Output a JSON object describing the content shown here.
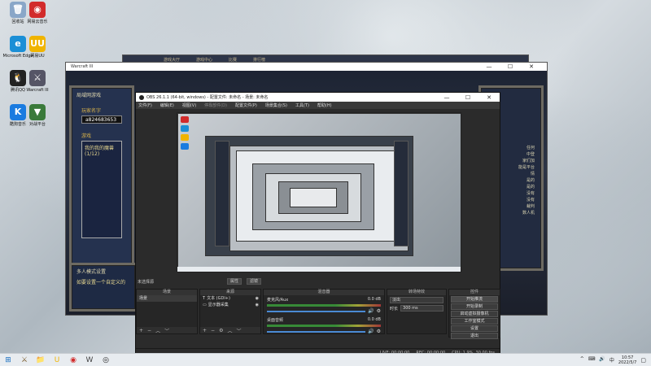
{
  "desktop_icons": [
    {
      "label": "回收站",
      "name": "recycle-bin-icon",
      "glyph": "🗑",
      "color": "#8aa7c8"
    },
    {
      "label": "网易云音乐",
      "name": "netease-music-icon",
      "glyph": "◉",
      "color": "#d22b2b"
    },
    {
      "label": "Microsoft Edge",
      "name": "edge-icon",
      "glyph": "e",
      "color": "#1b8fd6"
    },
    {
      "label": "网易UU",
      "name": "uu-icon",
      "glyph": "UU",
      "color": "#f0b400"
    },
    {
      "label": "腾讯QQ",
      "name": "qq-icon",
      "glyph": "🐧",
      "color": "#222"
    },
    {
      "label": "Warcraft III",
      "name": "warcraft-icon",
      "glyph": "⚔",
      "color": "#556"
    },
    {
      "label": "酷狗音乐",
      "name": "kugou-icon",
      "glyph": "K",
      "color": "#1a7be0"
    },
    {
      "label": "对战平台",
      "name": "battle-platform-icon",
      "glyph": "▼",
      "color": "#3a7a3a"
    }
  ],
  "war3": {
    "title": "Warcraft III",
    "portal_tabs": [
      "游戏大厅",
      "游戏中心",
      "比赛",
      "排行榜"
    ],
    "lan_title": "局域网游戏",
    "player_name_label": "玩家名字",
    "player_name_value": "a824683653",
    "games_label": "游戏",
    "game_item": "我的我的魔兽 (1/12)",
    "multiplayer_title": "多人模式设置",
    "multiplayer_hint": "如要设置一个自定义的",
    "right_lines": [
      "任何",
      "中登",
      "家们加",
      "能是平台",
      "情",
      "是的",
      "是的",
      "没有",
      "没有",
      "裁判",
      "数人机"
    ]
  },
  "obs": {
    "title": "OBS 26.1.1 (64-bit, windows) - 配置文件: 未命名 - 场景: 未命名",
    "menu": [
      "文件(F)",
      "编辑(E)",
      "视图(V)",
      "停靠部件(D)",
      "配置文件(P)",
      "场景集合(S)",
      "工具(T)",
      "帮助(H)"
    ],
    "no_source": "未选择源",
    "props_btn": "属性",
    "filters_btn": "滤镜",
    "docks": {
      "scenes": {
        "title": "场景",
        "items": [
          "场景"
        ]
      },
      "sources": {
        "title": "来源",
        "items": [
          {
            "label": "文本 (GDI+)",
            "icon": "text-icon"
          },
          {
            "label": "显示器采集",
            "icon": "monitor-icon"
          }
        ]
      },
      "mixer": {
        "title": "混音器",
        "tracks": [
          {
            "name": "麦克风/Aux",
            "db": "0.0 dB"
          },
          {
            "name": "桌面音频",
            "db": "0.0 dB"
          }
        ]
      },
      "transitions": {
        "title": "转场特效",
        "type": "淡出",
        "duration_label": "时长",
        "duration_value": "300 ms"
      },
      "controls": {
        "title": "控件",
        "buttons": [
          "开始推流",
          "开始录制",
          "启动虚拟摄像机",
          "工作室模式",
          "设置",
          "退出"
        ]
      }
    },
    "status": {
      "live": "LIVE: 00:00:00",
      "rec": "REC: 00:00:00",
      "cpu": "CPU: 1.9%, 30.00 fps"
    }
  },
  "taskbar": {
    "time": "10:57",
    "date": "2022/5/7",
    "icons": [
      {
        "name": "start-icon",
        "glyph": "⊞",
        "color": "#1a6fc0"
      },
      {
        "name": "warcraft-task-icon",
        "glyph": "⚔",
        "color": "#7a5a2a"
      },
      {
        "name": "explorer-icon",
        "glyph": "📁",
        "color": "#e0a020"
      },
      {
        "name": "uu-task-icon",
        "glyph": "U",
        "color": "#f0b400"
      },
      {
        "name": "netease-task-icon",
        "glyph": "◉",
        "color": "#d22b2b"
      },
      {
        "name": "war3-task-icon",
        "glyph": "W",
        "color": "#444"
      },
      {
        "name": "obs-task-icon",
        "glyph": "◎",
        "color": "#222"
      }
    ],
    "tray": [
      "^",
      "⌨",
      "🔊",
      "中"
    ]
  }
}
